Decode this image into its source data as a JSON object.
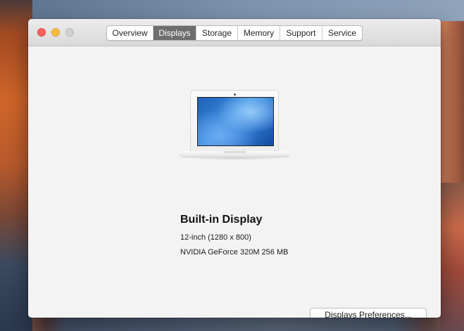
{
  "window": {
    "traffic_lights": [
      "close",
      "minimize",
      "zoom"
    ]
  },
  "tabs": [
    {
      "label": "Overview",
      "selected": false
    },
    {
      "label": "Displays",
      "selected": true
    },
    {
      "label": "Storage",
      "selected": false
    },
    {
      "label": "Memory",
      "selected": false
    },
    {
      "label": "Support",
      "selected": false
    },
    {
      "label": "Service",
      "selected": false
    }
  ],
  "display": {
    "name": "Built-in Display",
    "size": "12-inch (1280 x 800)",
    "graphics": "NVIDIA GeForce 320M 256 MB",
    "icon": "laptop-icon"
  },
  "buttons": {
    "preferences_label": "Displays Preferences..."
  },
  "colors": {
    "close": "#fc605c",
    "minimize": "#fdbc40",
    "zoom_disabled": "#d0d0d0",
    "selected_tab": "#6e6e6e"
  }
}
